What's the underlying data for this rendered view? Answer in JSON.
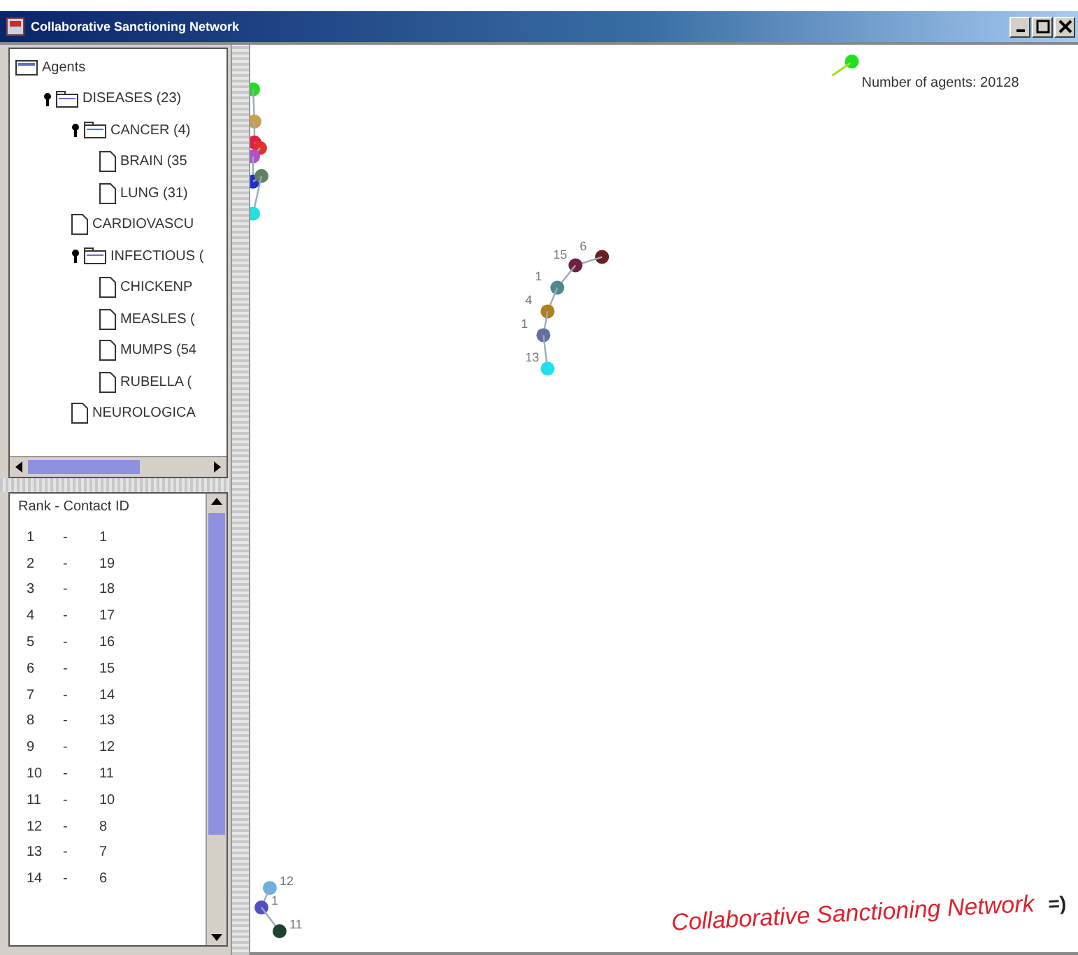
{
  "window": {
    "title": "Collaborative Sanctioning Network"
  },
  "tree": [
    {
      "label": "Agents",
      "kind": "root",
      "expanded": true,
      "children": [
        {
          "label": "DISEASES (23)",
          "kind": "folder",
          "expanded": true,
          "children": [
            {
              "label": "CANCER (4)",
              "kind": "folder",
              "expanded": true,
              "children": [
                {
                  "label": "BRAIN (35",
                  "kind": "file"
                },
                {
                  "label": "LUNG (31)",
                  "kind": "file"
                }
              ]
            },
            {
              "label": "CARDIOVASCU",
              "kind": "file"
            },
            {
              "label": "INFECTIOUS (",
              "kind": "folder",
              "expanded": true,
              "children": [
                {
                  "label": "CHICKENP",
                  "kind": "file"
                },
                {
                  "label": "MEASLES (",
                  "kind": "file"
                },
                {
                  "label": "MUMPS (54",
                  "kind": "file"
                },
                {
                  "label": "RUBELLA (",
                  "kind": "file"
                }
              ]
            },
            {
              "label": "NEUROLOGICA",
              "kind": "file"
            }
          ]
        }
      ]
    }
  ],
  "ranking": {
    "header": "Rank - Contact ID",
    "rows": [
      {
        "rank": "1",
        "sep": "-",
        "contact": "1"
      },
      {
        "rank": "2",
        "sep": "-",
        "contact": "19"
      },
      {
        "rank": "3",
        "sep": "-",
        "contact": "18"
      },
      {
        "rank": "4",
        "sep": "-",
        "contact": "17"
      },
      {
        "rank": "5",
        "sep": "-",
        "contact": "16"
      },
      {
        "rank": "6",
        "sep": "-",
        "contact": "15"
      },
      {
        "rank": "7",
        "sep": "-",
        "contact": "14"
      },
      {
        "rank": "8",
        "sep": "-",
        "contact": "13"
      },
      {
        "rank": "9",
        "sep": "-",
        "contact": "12"
      },
      {
        "rank": "10",
        "sep": "-",
        "contact": "11"
      },
      {
        "rank": "11",
        "sep": "-",
        "contact": "10"
      },
      {
        "rank": "12",
        "sep": "-",
        "contact": "8"
      },
      {
        "rank": "13",
        "sep": "-",
        "contact": "7"
      },
      {
        "rank": "14",
        "sep": "-",
        "contact": "6"
      }
    ]
  },
  "graph": {
    "agent_count": "Number of agents: 20128",
    "chains": [
      [
        {
          "color": "#22dd22"
        },
        {
          "color": "#c8a050"
        },
        {
          "color": "#e02040"
        },
        {
          "color": "#e03030"
        },
        {
          "color": "#b050d0"
        },
        {
          "color": "#2030d0"
        },
        {
          "color": "#608060"
        },
        {
          "color": "#20e0e0"
        }
      ],
      [
        {
          "color": "#6a2020",
          "label": "6"
        },
        {
          "color": "#702040",
          "label": "15"
        },
        {
          "color": "#508890",
          "label": "1"
        },
        {
          "color": "#b08020",
          "label": "4"
        },
        {
          "color": "#6070a0",
          "label": "1"
        },
        {
          "color": "#20e0f0",
          "label": "13"
        }
      ],
      [
        {
          "color": "#70b0e0",
          "label": "12"
        },
        {
          "color": "#5050c0",
          "label": "1"
        },
        {
          "color": "#204030",
          "label": "11"
        }
      ],
      [
        {
          "color": "#20e020"
        }
      ]
    ]
  },
  "banner": {
    "text": "Collaborative Sanctioning Network",
    "smiley": "=)"
  }
}
